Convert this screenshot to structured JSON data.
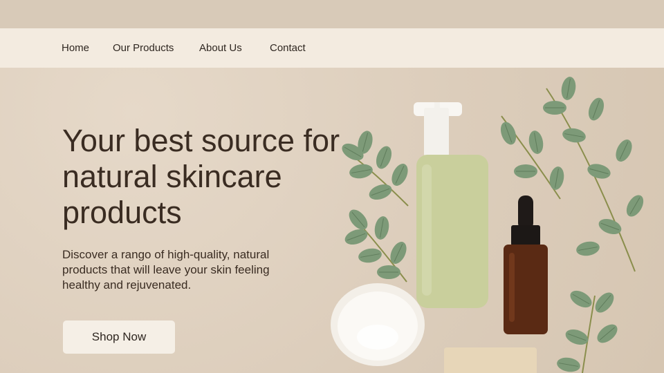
{
  "nav": {
    "items": [
      {
        "label": "Home"
      },
      {
        "label": "Our Products"
      },
      {
        "label": "About Us"
      },
      {
        "label": "Contact"
      }
    ]
  },
  "hero": {
    "title": "Your best source for natural skincare products",
    "text": "Discover a rango of high-quality, natural products that will leave your skin feeling healthy and rejuvenated.",
    "cta_label": "Shop Now"
  },
  "colors": {
    "background": "#dccdbb",
    "nav_background": "#f3ebe0",
    "text": "#3a2c22",
    "leaf": "#7d9a78",
    "bottle": "#c9cf9c",
    "amber": "#5a2a14"
  }
}
